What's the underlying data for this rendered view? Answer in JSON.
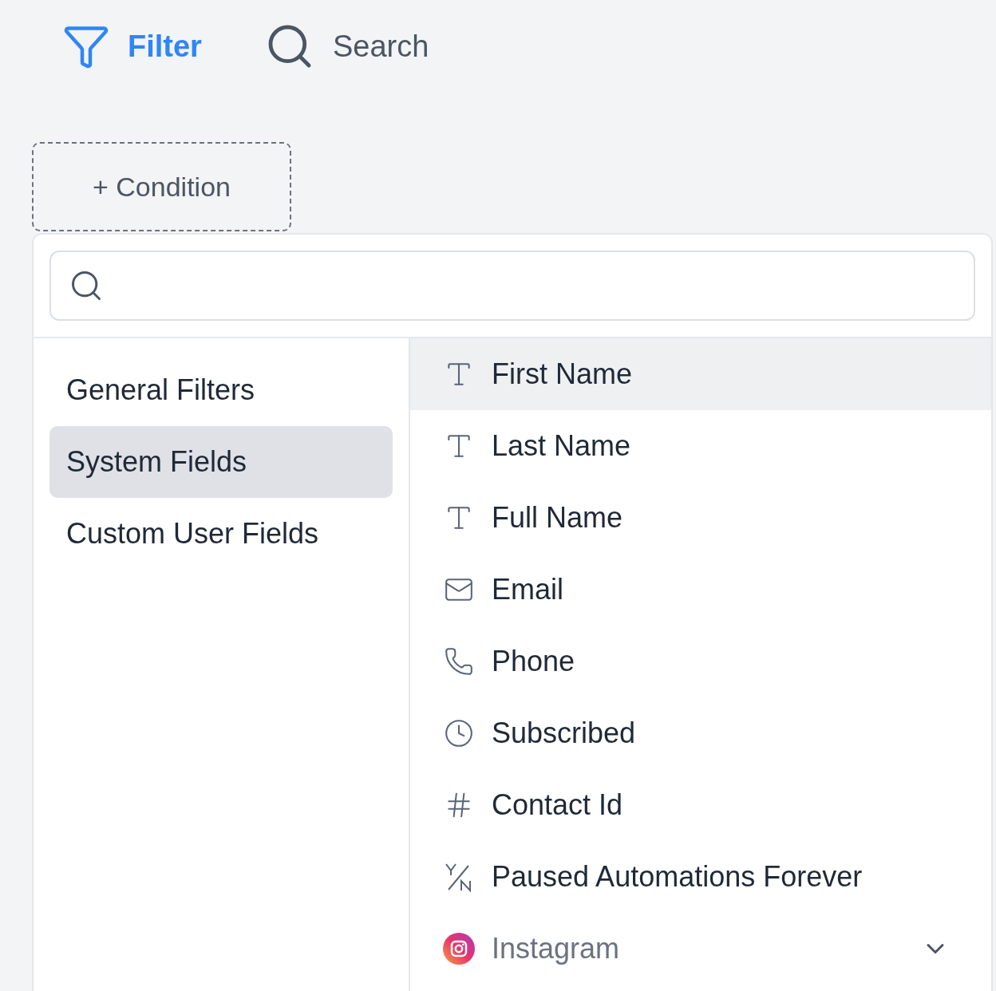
{
  "toolbar": [
    {
      "kind": "filter",
      "label": "Filter",
      "selected": true
    },
    {
      "kind": "search",
      "label": "Search",
      "selected": false
    }
  ],
  "condition_button": {
    "label": "+ Condition"
  },
  "dropdown": {
    "categories": [
      {
        "label": "General Filters",
        "selected": false
      },
      {
        "label": "System Fields",
        "selected": true
      },
      {
        "label": "Custom User Fields",
        "selected": false
      }
    ],
    "fields": [
      {
        "kind": "text",
        "label": "First Name",
        "selected": true
      },
      {
        "kind": "text",
        "label": "Last Name",
        "selected": false
      },
      {
        "kind": "text",
        "label": "Full Name",
        "selected": false
      },
      {
        "kind": "email",
        "label": "Email",
        "selected": false
      },
      {
        "kind": "phone",
        "label": "Phone",
        "selected": false
      },
      {
        "kind": "date",
        "label": "Subscribed",
        "selected": false
      },
      {
        "kind": "number",
        "label": "Contact Id",
        "selected": false
      },
      {
        "kind": "boolean",
        "label": "Paused Automations Forever",
        "selected": false
      },
      {
        "kind": "instagram",
        "label": "Instagram",
        "selected": false,
        "expanded": false
      }
    ]
  }
}
